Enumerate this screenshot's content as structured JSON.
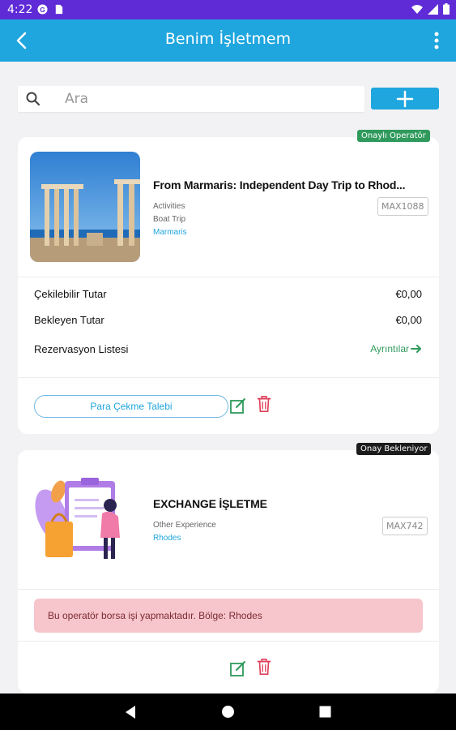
{
  "status_bar": {
    "time": "4:22",
    "icons": [
      "g-icon",
      "sim-icon",
      "wifi-icon",
      "signal-icon",
      "battery-icon"
    ]
  },
  "app_bar": {
    "title": "Benim İşletmem",
    "icons": [
      "back-arrow-icon",
      "more-vert-icon"
    ]
  },
  "search": {
    "placeholder": "Ara",
    "value": "",
    "icon": "search-icon"
  },
  "add_button": {
    "icon": "plus-icon"
  },
  "colors": {
    "status_bar": "#5e2bd6",
    "app_bar": "#1fa6de",
    "approved_badge": "#2f9a5c",
    "pending_badge": "#1c1c1c",
    "alert_bg": "#f7c6cc",
    "edit_icon": "#2f9a5c",
    "delete_icon": "#e0405a"
  },
  "cards": [
    {
      "badge": "Onaylı Operatör",
      "title": "From Marmaris: Independent Day Trip to Rhod...",
      "category": "Activities",
      "type": "Boat Trip",
      "location": "Marmaris",
      "code": "MAX1088",
      "rows": [
        {
          "label": "Çekilebilir Tutar",
          "value": "€0,00"
        },
        {
          "label": "Bekleyen Tutar",
          "value": "€0,00"
        },
        {
          "label": "Rezervasyon Listesi",
          "link": "Ayrıntılar"
        }
      ],
      "withdraw_button": "Para Çekme Talebi",
      "actions": [
        "edit-icon",
        "delete-icon"
      ]
    },
    {
      "badge": "Onay Bekleniyor",
      "title": "EXCHANGE İŞLETME",
      "category": "Other Experience",
      "location": "Rhodes",
      "code": "MAX742",
      "alert": "Bu operatör borsa işi yapmaktadır. Bölge: Rhodes",
      "actions": [
        "edit-icon",
        "delete-icon"
      ]
    }
  ],
  "nav_bar": {
    "icons": [
      "back-triangle-icon",
      "home-circle-icon",
      "recents-square-icon"
    ]
  }
}
